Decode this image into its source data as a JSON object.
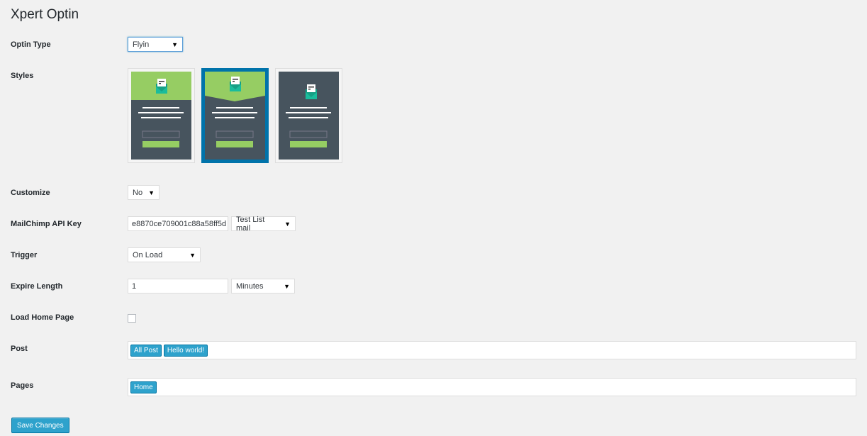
{
  "page": {
    "title": "Xpert Optin"
  },
  "fields": {
    "optin_type": {
      "label": "Optin Type",
      "value": "Flyin"
    },
    "styles": {
      "label": "Styles",
      "selected_index": 1
    },
    "customize": {
      "label": "Customize",
      "value": "No"
    },
    "mailchimp": {
      "label": "MailChimp API Key",
      "api_key": "e8870ce709001c88a58ff5d",
      "list": "Test List mail"
    },
    "trigger": {
      "label": "Trigger",
      "value": "On Load"
    },
    "expire": {
      "label": "Expire Length",
      "value": "1",
      "unit": "Minutes"
    },
    "load_home": {
      "label": "Load Home Page",
      "checked": false
    },
    "post": {
      "label": "Post",
      "tags": [
        "All Post",
        "Hello world!"
      ]
    },
    "pages": {
      "label": "Pages",
      "tags": [
        "Home"
      ]
    }
  },
  "buttons": {
    "save": "Save Changes"
  },
  "icons": {
    "dropdown": "triangle-down-icon",
    "envelope": "envelope-icon"
  },
  "colors": {
    "accent": "#0073aa",
    "button": "#2ea2cc",
    "style_green": "#96cd63",
    "style_dark": "#47545e"
  }
}
